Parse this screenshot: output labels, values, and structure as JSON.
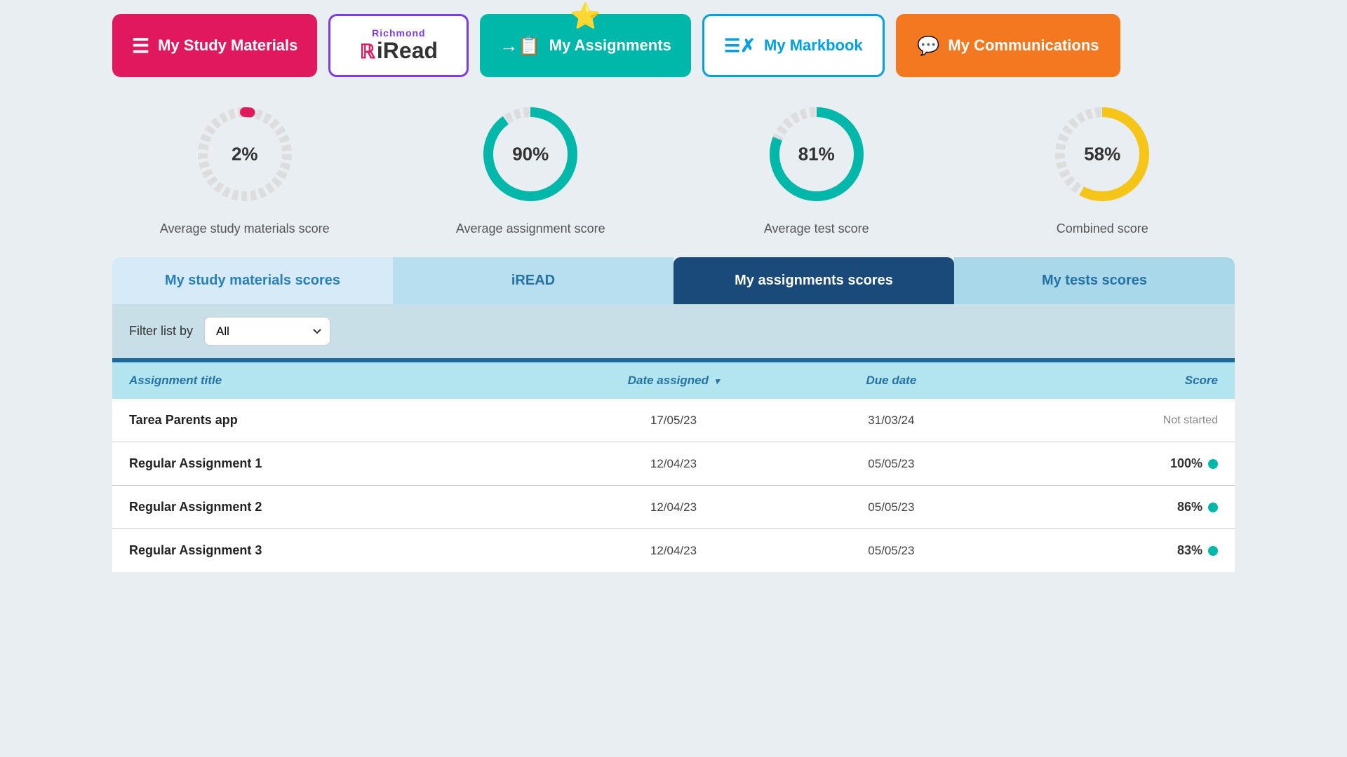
{
  "nav": {
    "study_materials_label": "My Study Materials",
    "iread_label": "iRead",
    "richmond_label": "Richmond",
    "assignments_label": "My Assignments",
    "markbook_label": "My Markbook",
    "communications_label": "My Communications"
  },
  "scores": {
    "study_pct": "2%",
    "assignment_pct": "90%",
    "test_pct": "81%",
    "combined_pct": "58%",
    "study_label": "Average study materials score",
    "assignment_label": "Average assignment score",
    "test_label": "Average test score",
    "combined_label": "Combined score"
  },
  "tabs": {
    "study_label": "My study materials scores",
    "iread_label": "iREAD",
    "assignments_label": "My assignments scores",
    "tests_label": "My tests scores"
  },
  "filter": {
    "label": "Filter list by",
    "value": "All"
  },
  "table": {
    "headers": {
      "title": "Assignment title",
      "date_assigned": "Date assigned",
      "due_date": "Due date",
      "score": "Score"
    },
    "rows": [
      {
        "title": "Tarea Parents app",
        "date_assigned": "17/05/23",
        "due_date": "31/03/24",
        "score": "Not started",
        "has_dot": false
      },
      {
        "title": "Regular Assignment 1",
        "date_assigned": "12/04/23",
        "due_date": "05/05/23",
        "score": "100%",
        "has_dot": true
      },
      {
        "title": "Regular Assignment 2",
        "date_assigned": "12/04/23",
        "due_date": "05/05/23",
        "score": "86%",
        "has_dot": true
      },
      {
        "title": "Regular Assignment 3",
        "date_assigned": "12/04/23",
        "due_date": "05/05/23",
        "score": "83%",
        "has_dot": true
      }
    ]
  },
  "donut_study": {
    "pct": 2,
    "color": "#e0185e",
    "bg": "#ddd"
  },
  "donut_assignment": {
    "pct": 90,
    "color": "#00b8a9",
    "bg": "#ddd"
  },
  "donut_test": {
    "pct": 81,
    "color": "#00b8a9",
    "bg": "#ddd"
  },
  "donut_combined": {
    "pct": 58,
    "color": "#f5c518",
    "bg": "#ddd"
  }
}
